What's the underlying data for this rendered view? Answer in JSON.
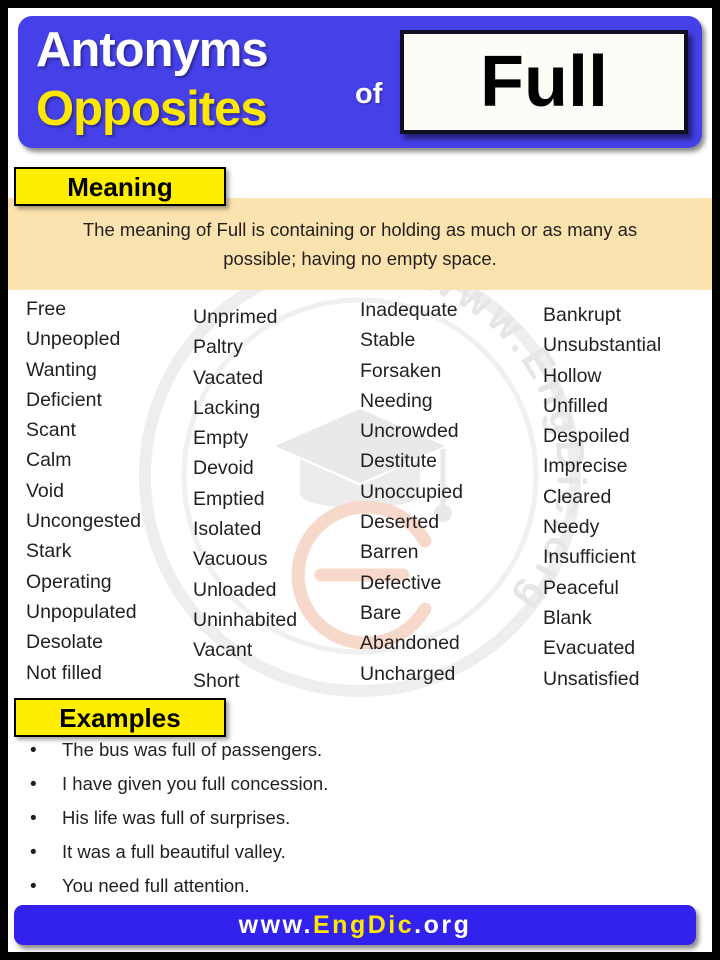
{
  "header": {
    "line1": "Antonyms",
    "line2": "Opposites",
    "connector": "of",
    "word": "Full",
    "colors": {
      "panel_blue": "#4540e8",
      "accent_yellow": "#ffe800",
      "white": "#ffffff"
    }
  },
  "meaning": {
    "label": "Meaning",
    "text": "The meaning of Full is containing or holding as much or as many as possible; having no empty space.",
    "background": "#fae3ae"
  },
  "antonyms": {
    "columns": [
      {
        "items": [
          "Free",
          "Unpeopled",
          "Wanting",
          "Deficient",
          "Scant",
          "Calm",
          "Void",
          "Uncongested",
          "Stark",
          "Operating",
          "Unpopulated",
          "Desolate",
          "Not filled"
        ]
      },
      {
        "items": [
          "Unprimed",
          "Paltry",
          "Vacated",
          "Lacking",
          "Empty",
          "Devoid",
          "Emptied",
          "Isolated",
          "Vacuous",
          "Unloaded",
          "Uninhabited",
          "Vacant",
          "Short"
        ]
      },
      {
        "items": [
          "Inadequate",
          "Stable",
          "Forsaken",
          "Needing",
          "Uncrowded",
          "Destitute",
          "Unoccupied",
          "Deserted",
          "Barren",
          "Defective",
          "Bare",
          "Abandoned",
          "Uncharged"
        ]
      },
      {
        "items": [
          "Bankrupt",
          "Unsubstantial",
          "Hollow",
          "Unfilled",
          "Despoiled",
          "Imprecise",
          "Cleared",
          "Needy",
          "Insufficient",
          "Peaceful",
          "Blank",
          "Evacuated",
          "Unsatisfied"
        ]
      }
    ]
  },
  "examples": {
    "label": "Examples",
    "bullet": "•",
    "items": [
      "The bus was full of passengers.",
      "I have given you full concession.",
      "His life was full of surprises.",
      "It was a full beautiful valley.",
      "You need full attention."
    ]
  },
  "footer": {
    "prefix": "www.",
    "brand": "EngDic",
    "suffix": ".org",
    "background": "#3322ee"
  },
  "watermark": {
    "ring_text": "www.EngDic.org",
    "logo": "graduation-cap-and-e-monogram"
  }
}
